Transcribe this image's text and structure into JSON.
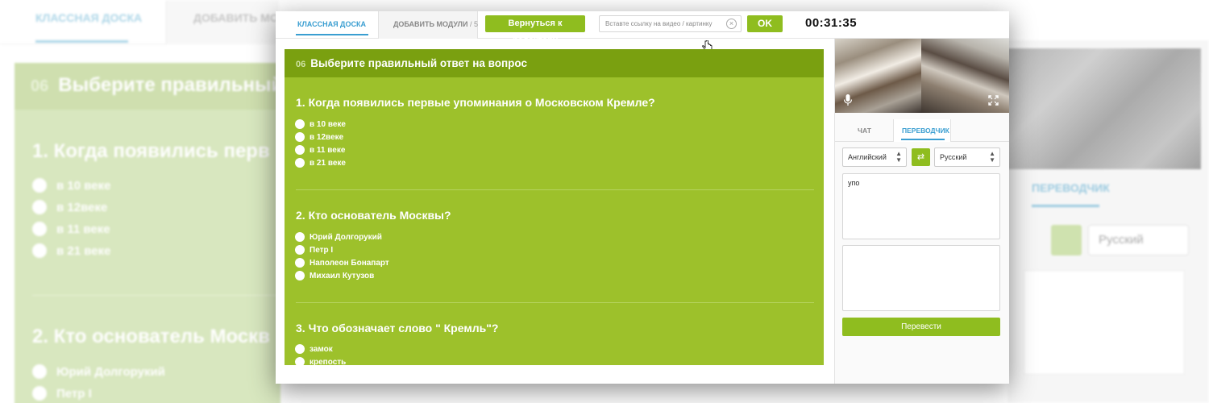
{
  "tabs": {
    "board": "КЛАССНАЯ ДОСКА",
    "modules": "ДОБАВИТЬ МОДУЛИ",
    "modules_count": "/ 5"
  },
  "toolbar": {
    "back_label": "Вернуться к редактору",
    "url_placeholder": "Вставте ссылку на видео / картинку",
    "ok_label": "OK",
    "timer": "00:31:35"
  },
  "quiz": {
    "number": "06",
    "title": "Выберите правильный ответ на вопрос",
    "questions": [
      {
        "text": "1. Когда появились первые упоминания о Московском Кремле?",
        "options": [
          "в 10 веке",
          "в 12веке",
          "в 11 веке",
          "в 21 веке"
        ]
      },
      {
        "text": "2. Кто основатель Москвы?",
        "options": [
          "Юрий Долгорукий",
          "Петр I",
          "Наполеон Бонапарт",
          "Михаил Кутузов"
        ]
      },
      {
        "text": "3. Что обозначает слово \" Кремль\"?",
        "options": [
          "замок",
          "крепость"
        ]
      }
    ]
  },
  "sidebar": {
    "tab_chat": "ЧАТ",
    "tab_translator": "ПЕРЕВОДЧИК",
    "source_lang": "Английский",
    "target_lang": "Русский",
    "source_text": "упо",
    "result_text": "",
    "translate_label": "Перевести"
  },
  "background": {
    "tab_board": "КЛАССНАЯ ДОСКА",
    "tab_modules": "ДОБАВИТЬ МОДУ",
    "quiz_number": "06",
    "quiz_title": "Выберите правильный",
    "q1": "1. Когда появились перв",
    "q1_options": [
      "в 10 веке",
      "в 12веке",
      "в 11 веке",
      "в 21 веке"
    ],
    "q2": "2. Кто основатель Москв",
    "q2_options": [
      "Юрий Долгорукий",
      "Петр I"
    ],
    "translator_tab": "ПЕРЕВОДЧИК",
    "target_lang": "Русский"
  },
  "colors": {
    "accent_green": "#8fbd1f",
    "quiz_green": "#9dc12b",
    "quiz_header": "#7aa010",
    "tab_blue": "#3a9ed1"
  }
}
